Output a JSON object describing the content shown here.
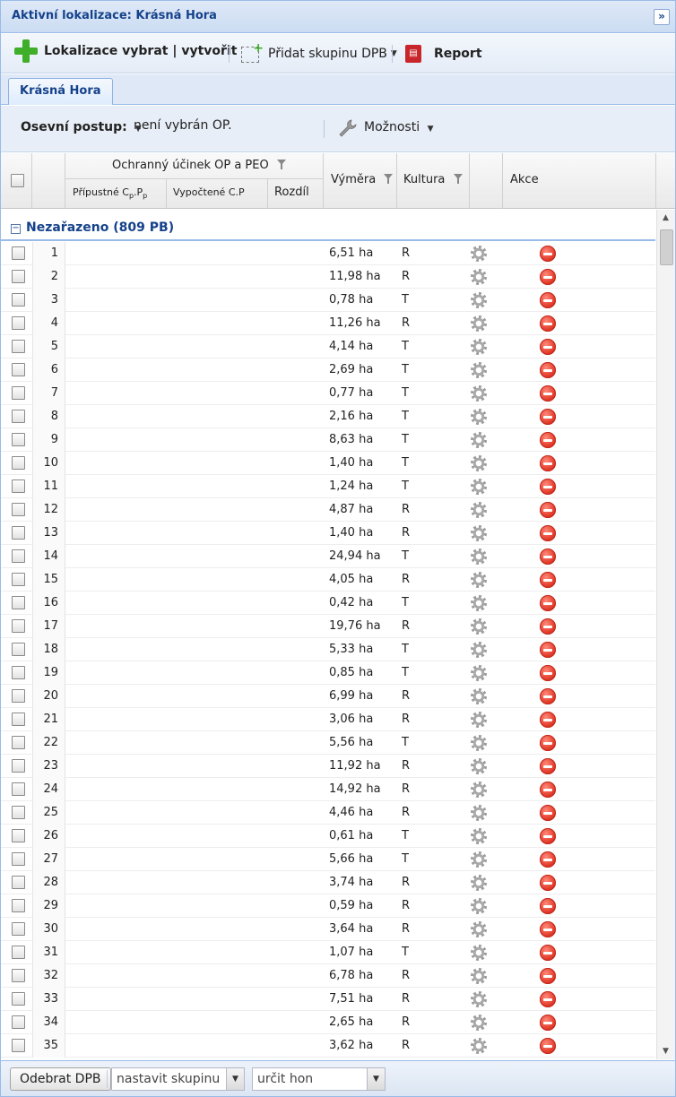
{
  "header": {
    "title": "Aktivní lokalizace: Krásná Hora",
    "collapse_glyph": "»"
  },
  "toolbar": {
    "locate_label": "Lokalizace vybrat | vytvořit",
    "add_group_label": "Přidat skupinu DPB",
    "report_label": "Report"
  },
  "tabs": [
    {
      "label": "Krásná Hora",
      "active": true
    }
  ],
  "filter": {
    "label": "Osevní postup:",
    "value": "není vybrán OP.",
    "options_label": "Možnosti"
  },
  "grid": {
    "columns": {
      "effect_group": "Ochranný účinek OP a PEO",
      "allowed_prefix": "Přípustné C",
      "allowed_sub1": "p",
      "allowed_mid": ".P",
      "allowed_sub2": "p",
      "computed": "Vypočtené C.P",
      "difference": "Rozdíl",
      "area": "Výměra",
      "crop": "Kultura",
      "actions": "Akce"
    },
    "group_label": "Nezařazeno (809 PB)",
    "rows": [
      {
        "num": "1",
        "area": "6,51 ha",
        "crop": "R"
      },
      {
        "num": "2",
        "area": "11,98 ha",
        "crop": "R"
      },
      {
        "num": "3",
        "area": "0,78 ha",
        "crop": "T"
      },
      {
        "num": "4",
        "area": "11,26 ha",
        "crop": "R"
      },
      {
        "num": "5",
        "area": "4,14 ha",
        "crop": "T"
      },
      {
        "num": "6",
        "area": "2,69 ha",
        "crop": "T"
      },
      {
        "num": "7",
        "area": "0,77 ha",
        "crop": "T"
      },
      {
        "num": "8",
        "area": "2,16 ha",
        "crop": "T"
      },
      {
        "num": "9",
        "area": "8,63 ha",
        "crop": "T"
      },
      {
        "num": "10",
        "area": "1,40 ha",
        "crop": "T"
      },
      {
        "num": "11",
        "area": "1,24 ha",
        "crop": "T"
      },
      {
        "num": "12",
        "area": "4,87 ha",
        "crop": "R"
      },
      {
        "num": "13",
        "area": "1,40 ha",
        "crop": "R"
      },
      {
        "num": "14",
        "area": "24,94 ha",
        "crop": "T"
      },
      {
        "num": "15",
        "area": "4,05 ha",
        "crop": "R"
      },
      {
        "num": "16",
        "area": "0,42 ha",
        "crop": "T"
      },
      {
        "num": "17",
        "area": "19,76 ha",
        "crop": "R"
      },
      {
        "num": "18",
        "area": "5,33 ha",
        "crop": "T"
      },
      {
        "num": "19",
        "area": "0,85 ha",
        "crop": "T"
      },
      {
        "num": "20",
        "area": "6,99 ha",
        "crop": "R"
      },
      {
        "num": "21",
        "area": "3,06 ha",
        "crop": "R"
      },
      {
        "num": "22",
        "area": "5,56 ha",
        "crop": "T"
      },
      {
        "num": "23",
        "area": "11,92 ha",
        "crop": "R"
      },
      {
        "num": "24",
        "area": "14,92 ha",
        "crop": "R"
      },
      {
        "num": "25",
        "area": "4,46 ha",
        "crop": "R"
      },
      {
        "num": "26",
        "area": "0,61 ha",
        "crop": "T"
      },
      {
        "num": "27",
        "area": "5,66 ha",
        "crop": "T"
      },
      {
        "num": "28",
        "area": "3,74 ha",
        "crop": "R"
      },
      {
        "num": "29",
        "area": "0,59 ha",
        "crop": "R"
      },
      {
        "num": "30",
        "area": "3,64 ha",
        "crop": "R"
      },
      {
        "num": "31",
        "area": "1,07 ha",
        "crop": "T"
      },
      {
        "num": "32",
        "area": "6,78 ha",
        "crop": "R"
      },
      {
        "num": "33",
        "area": "7,51 ha",
        "crop": "R"
      },
      {
        "num": "34",
        "area": "2,65 ha",
        "crop": "R"
      },
      {
        "num": "35",
        "area": "3,62 ha",
        "crop": "R"
      }
    ]
  },
  "bottombar": {
    "remove_label": "Odebrat DPB",
    "group_combo": "nastavit skupinu",
    "hon_combo": "určit hon"
  },
  "colors": {
    "accent": "#15428b",
    "add_green": "#3fae29",
    "remove_red": "#e23b2b"
  }
}
